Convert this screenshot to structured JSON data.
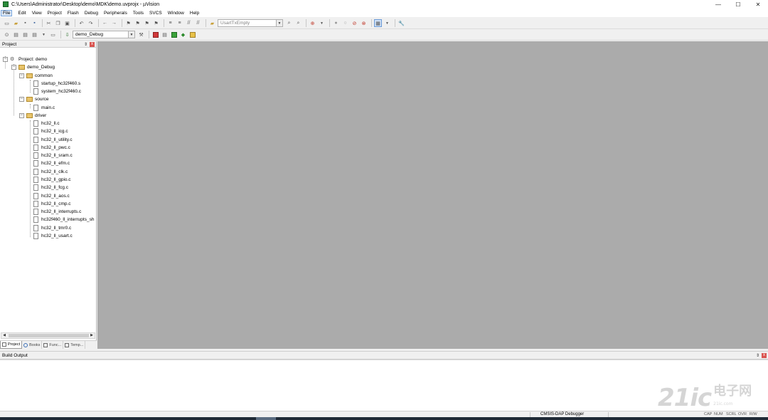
{
  "window": {
    "title": "C:\\Users\\Administrator\\Desktop\\demo\\MDK\\demo.uvprojx - µVision",
    "minimize": "—",
    "maximize": "☐",
    "close": "✕"
  },
  "menu": [
    "File",
    "Edit",
    "View",
    "Project",
    "Flash",
    "Debug",
    "Peripherals",
    "Tools",
    "SVCS",
    "Window",
    "Help"
  ],
  "toolbar": {
    "function_combo_value": "UsartTxEmpty",
    "target_combo_value": "demo_Debug"
  },
  "project_panel": {
    "title": "Project",
    "pin": "⇕",
    "close": "x",
    "root": "Project: demo",
    "target": "demo_Debug",
    "groups": [
      {
        "name": "common",
        "files": [
          "startup_hc32f460.s",
          "system_hc32f460.c"
        ]
      },
      {
        "name": "source",
        "files": [
          "main.c"
        ]
      },
      {
        "name": "driver",
        "files": [
          "hc32_ll.c",
          "hc32_ll_icg.c",
          "hc32_ll_utility.c",
          "hc32_ll_pwc.c",
          "hc32_ll_sram.c",
          "hc32_ll_efm.c",
          "hc32_ll_clk.c",
          "hc32_ll_gpio.c",
          "hc32_ll_fcg.c",
          "hc32_ll_aos.c",
          "hc32_ll_cmp.c",
          "hc32_ll_interrupts.c",
          "hc32f460_ll_interrupts_sh",
          "hc32_ll_tmr0.c",
          "hc32_ll_usart.c"
        ]
      }
    ],
    "tabs": [
      "Project",
      "Books",
      "Func...",
      "Temp..."
    ]
  },
  "build_output": {
    "title": "Build Output",
    "pin": "⇕",
    "close": "x"
  },
  "statusbar": {
    "debugger": "CMSIS-DAP Debugger",
    "indicators": [
      "CAP",
      "NUM",
      "SCRL",
      "OVR",
      "R/W"
    ]
  },
  "watermark": {
    "logo": "21ic",
    "text": "电子网",
    "sub": "21ic.com"
  },
  "colors": {
    "editor_background": "#ababab",
    "panel_background": "#ffffff",
    "chrome": "#f0f0f0"
  }
}
